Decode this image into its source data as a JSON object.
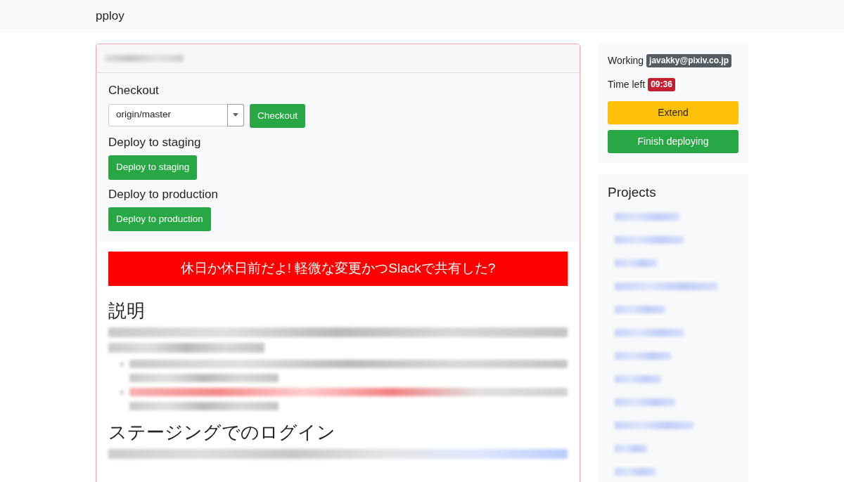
{
  "navbar": {
    "brand": "pploy"
  },
  "deploy_card": {
    "header": {
      "kind": "redacted"
    },
    "sections": [
      {
        "heading": "Checkout",
        "kind": "checkout",
        "select_value": "origin/master",
        "button": "Checkout"
      },
      {
        "heading": "Deploy to staging",
        "kind": "button",
        "button": "Deploy to staging"
      },
      {
        "heading": "Deploy to production",
        "kind": "button",
        "button": "Deploy to production"
      }
    ],
    "alert": "休日か休日前だよ! 軽微な変更かつSlackで共有した?",
    "readme": [
      {
        "kind": "heading",
        "text": "説明"
      },
      {
        "kind": "redacted-paragraph",
        "lines": [
          {
            "kind": "grey",
            "full": true
          },
          {
            "kind": "grey",
            "full": false
          }
        ]
      },
      {
        "kind": "redacted-list",
        "items": [
          {
            "lines": [
              {
                "kind": "grey",
                "full": true
              },
              {
                "kind": "grey",
                "full": false
              }
            ]
          },
          {
            "lines": [
              {
                "kind": "red-grey",
                "full": true
              },
              {
                "kind": "grey",
                "full": false
              }
            ]
          }
        ]
      },
      {
        "kind": "heading",
        "text": "ステージングでのログイン"
      },
      {
        "kind": "redacted-paragraph",
        "lines": [
          {
            "kind": "grey-blue",
            "full": true
          }
        ]
      }
    ]
  },
  "status": {
    "working_label": "Working",
    "user": "javakky@pixiv.co.jp",
    "time_label": "Time left",
    "time_left": "09:36",
    "extend_button": "Extend",
    "finish_button": "Finish deploying"
  },
  "projects": {
    "title": "Projects",
    "items": [
      {
        "kind": "redacted"
      },
      {
        "kind": "redacted"
      },
      {
        "kind": "redacted"
      },
      {
        "kind": "redacted"
      },
      {
        "kind": "redacted"
      },
      {
        "kind": "redacted"
      },
      {
        "kind": "redacted"
      },
      {
        "kind": "redacted"
      },
      {
        "kind": "redacted"
      },
      {
        "kind": "redacted"
      },
      {
        "kind": "redacted"
      },
      {
        "kind": "redacted"
      }
    ]
  }
}
